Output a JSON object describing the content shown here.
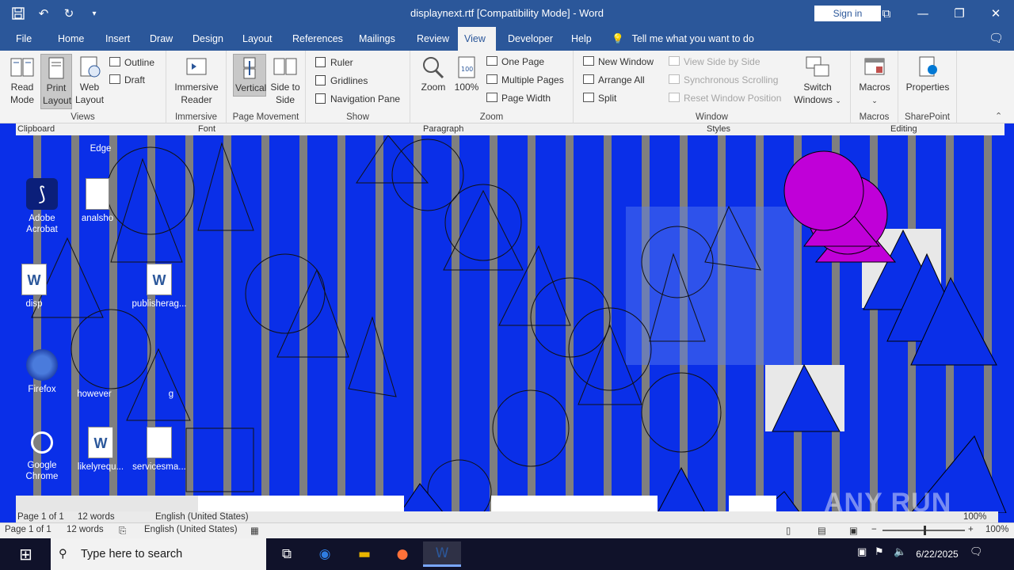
{
  "window": {
    "title": "displaynext.rtf [Compatibility Mode]  -  Word",
    "signin_label": "Sign in",
    "qat_icons": [
      "save-icon",
      "undo-icon",
      "redo-icon",
      "customize-icon"
    ]
  },
  "tabs": [
    {
      "label": "File"
    },
    {
      "label": "Home"
    },
    {
      "label": "Insert"
    },
    {
      "label": "Draw"
    },
    {
      "label": "Design"
    },
    {
      "label": "Layout"
    },
    {
      "label": "References"
    },
    {
      "label": "Mailings"
    },
    {
      "label": "Review"
    },
    {
      "label": "View",
      "active": true
    },
    {
      "label": "Developer"
    },
    {
      "label": "Help"
    }
  ],
  "tell_me": "Tell me what you want to do",
  "ribbon": {
    "views": {
      "label": "Views",
      "read_mode": "Read Mode",
      "print_layout": "Print Layout",
      "web_layout": "Web Layout",
      "outline": "Outline",
      "draft": "Draft"
    },
    "immersive": {
      "label": "Immersive",
      "reader": "Immersive Reader"
    },
    "page_movement": {
      "label": "Page Movement",
      "vertical": "Vertical",
      "side_to_side": "Side to Side"
    },
    "show": {
      "label": "Show",
      "ruler": "Ruler",
      "gridlines": "Gridlines",
      "navigation_pane": "Navigation Pane"
    },
    "zoom": {
      "label": "Zoom",
      "zoom": "Zoom",
      "percent": "100%",
      "one_page": "One Page",
      "multiple_pages": "Multiple Pages",
      "page_width": "Page Width"
    },
    "window": {
      "label": "Window",
      "new_window": "New Window",
      "arrange_all": "Arrange All",
      "split": "Split",
      "view_side_by_side": "View Side by Side",
      "sync_scrolling": "Synchronous Scrolling",
      "reset_position": "Reset Window Position",
      "switch_windows": "Switch Windows"
    },
    "macros": {
      "label": "Macros",
      "macros": "Macros"
    },
    "sharepoint": {
      "label": "SharePoint",
      "properties": "Properties"
    }
  },
  "ghost_ribbon": {
    "clipboard": "Clipboard",
    "font": "Font",
    "paragraph": "Paragraph",
    "styles": "Styles",
    "editing": "Editing"
  },
  "desktop_icons": [
    {
      "label": "Edge"
    },
    {
      "label": "Adobe Acrobat"
    },
    {
      "label": "analsho"
    },
    {
      "label": "disp"
    },
    {
      "label": "publisherag..."
    },
    {
      "label": "Firefox"
    },
    {
      "label": "however"
    },
    {
      "label": "g"
    },
    {
      "label": "Google Chrome"
    },
    {
      "label": "likelyrequ..."
    },
    {
      "label": "servicesma..."
    }
  ],
  "status_ghost": {
    "page": "Page 1 of 1",
    "words": "12 words",
    "language": "English (United States)",
    "zoom": "100%"
  },
  "status": {
    "page": "Page 1 of 1",
    "words": "12 words",
    "language": "English (United States)",
    "zoom": "100%"
  },
  "taskbar": {
    "search_placeholder": "Type here to search",
    "date": "6/22/2025"
  },
  "watermark": "ANY RUN"
}
